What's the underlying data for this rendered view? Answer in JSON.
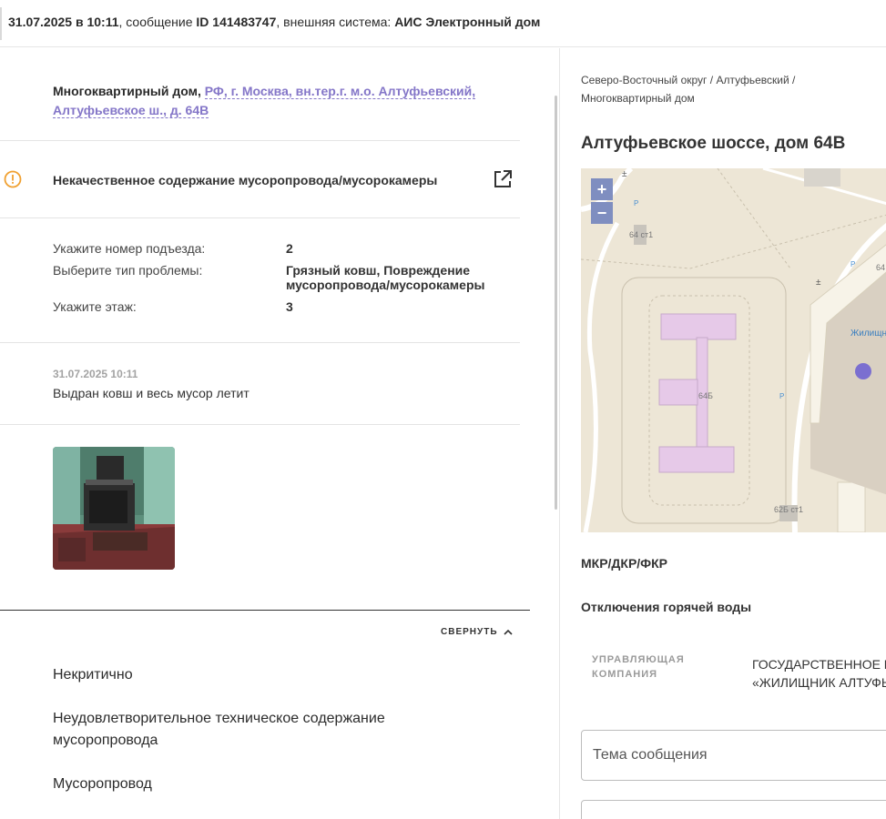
{
  "header": {
    "date_time": "31.07.2025 в 10:11",
    "message_prefix": ", сообщение ",
    "message_id": "ID 141483747",
    "system_prefix": ", внешняя система: ",
    "system_name": "АИС Электронный дом"
  },
  "address": {
    "type_label": "Многоквартирный дом,",
    "link": "РФ, г. Москва, вн.тер.г. м.о. Алтуфьевский, Алтуфьевское ш., д. 64В"
  },
  "issue": {
    "title": "Некачественное содержание мусоропровода/мусорокамеры",
    "warning_icon": "warning-circle-icon",
    "external_icon": "external-link-icon",
    "warning_color": "#f0a030"
  },
  "details": [
    {
      "label": "Укажите номер подъезда:",
      "value": "2"
    },
    {
      "label": "Выберите тип проблемы:",
      "value": "Грязный ковш, Повреждение мусоропровода/мусорокамеры"
    },
    {
      "label": "Укажите этаж:",
      "value": "3"
    }
  ],
  "comment": {
    "timestamp": "31.07.2025 10:11",
    "text": "Выдран ковш и весь мусор летит"
  },
  "collapse_label": "СВЕРНУТЬ",
  "categories": [
    "Некритично",
    "Неудовлетворительное техническое содержание мусоропровода",
    "Мусоропровод"
  ],
  "right": {
    "breadcrumb": [
      "Северо-Восточный округ",
      "Алтуфьевский",
      "Многоквартирный дом"
    ],
    "title": "Алтуфьевское шоссе, дом 64В",
    "map": {
      "labels": [
        "64 ст1",
        "64Б",
        "62Б ст1",
        "Жилищн",
        "64"
      ],
      "zoom_in": "+",
      "zoom_out": "−",
      "marker_color": "#7b6fd0"
    },
    "section1": "МКР/ДКР/ФКР",
    "section2": "Отключения горячей воды",
    "uk_label_line1": "УПРАВЛЯЮЩАЯ",
    "uk_label_line2": "КОМПАНИЯ",
    "uk_value_line1": "ГОСУДАРСТВЕННОЕ БЮ",
    "uk_value_line2": "«ЖИЛИЩНИК АЛТУФЬ",
    "subject_placeholder": "Тема сообщения",
    "message_placeholder": ""
  },
  "colors": {
    "accent": "#8476c8",
    "zoom_bg": "#7f8ec0",
    "building": "#e6c9e8"
  }
}
